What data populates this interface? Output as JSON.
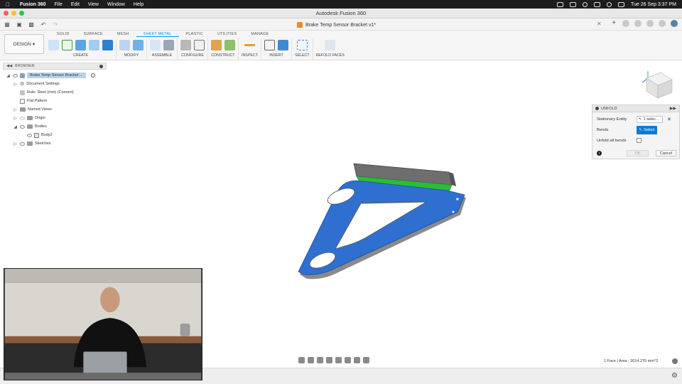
{
  "menubar": {
    "app_name": "Fusion 360",
    "items": [
      "File",
      "Edit",
      "View",
      "Window",
      "Help"
    ],
    "datetime": "Tue 26 Sep  3:37 PM"
  },
  "window": {
    "title": "Autodesk Fusion 360"
  },
  "document": {
    "tab_title": "Brake Temp Sensor Bracket v1*"
  },
  "ribbon": {
    "workspace": "DESIGN",
    "tabs": [
      "SOLID",
      "SURFACE",
      "MESH",
      "SHEET METAL",
      "PLASTIC",
      "UTILITIES",
      "MANAGE"
    ],
    "active_tab": "SHEET METAL",
    "groups": [
      "CREATE",
      "MODIFY",
      "ASSEMBLE",
      "CONFIGURE",
      "CONSTRUCT",
      "INSPECT",
      "INSERT",
      "SELECT",
      "REFOLD FACES"
    ]
  },
  "browser": {
    "header": "BROWSER",
    "root": "Brake Temp Sensor Bracket ...",
    "items": [
      "Document Settings",
      "Rule: Steel (mm) (Convert)",
      "Flat Pattern",
      "Named Views",
      "Origin",
      "Bodies",
      "Body2",
      "Sketches"
    ]
  },
  "unfold_panel": {
    "title": "UNFOLD",
    "stationary_entity_label": "Stationary Entity",
    "stationary_entity_value": "1 selec...",
    "bends_label": "Bends",
    "bends_button": "Select",
    "unfold_all_label": "Unfold all bends",
    "ok_label": "OK",
    "cancel_label": "Cancel"
  },
  "status": {
    "measure": "1 Face | Area : 3014.276 mm^2"
  },
  "colors": {
    "accent_blue": "#0696d7",
    "model_face": "#2f6fd0",
    "selected_bend": "#2bbd3a",
    "select_button": "#0b7ad6"
  }
}
